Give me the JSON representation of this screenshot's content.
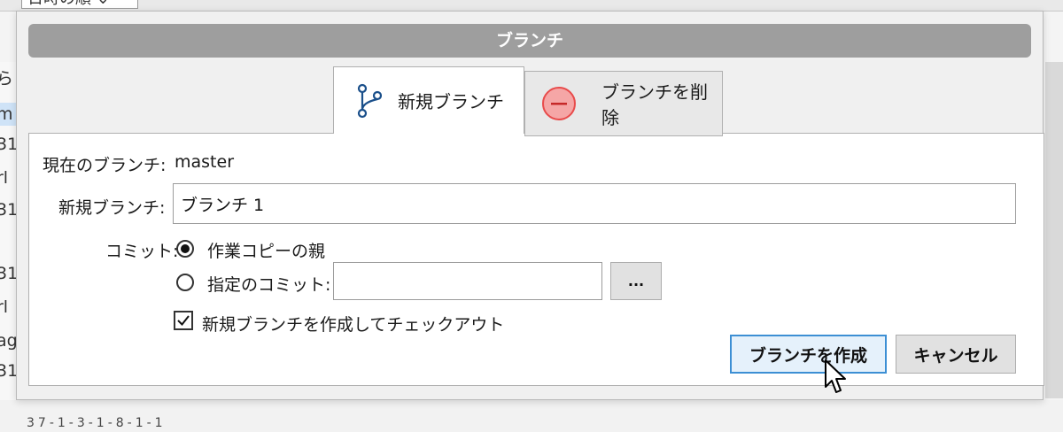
{
  "background": {
    "dropdown_text": "日時の順",
    "left_fragments": [
      "ら",
      "m",
      "31",
      "rl",
      "31",
      "31",
      "rl",
      "ag",
      "31"
    ],
    "bottom_text": "37-1-3-1-8-1-1"
  },
  "dialog": {
    "title": "ブランチ",
    "tabs": [
      {
        "label": "新規ブランチ",
        "icon": "branch-icon",
        "selected": true
      },
      {
        "label": "ブランチを削除",
        "icon": "delete-icon",
        "selected": false
      }
    ],
    "current_branch_label": "現在のブランチ:",
    "current_branch_value": "master",
    "new_branch_label": "新規ブランチ:",
    "new_branch_value": "ブランチ 1",
    "commit_label": "コミット:",
    "commit_options": [
      {
        "label": "作業コピーの親",
        "selected": true
      },
      {
        "label": "指定のコミット:",
        "selected": false
      }
    ],
    "specific_commit_value": "",
    "browse_label": "...",
    "checkout_label": "新規ブランチを作成してチェックアウト",
    "checkout_checked": true,
    "create_button": "ブランチを作成",
    "cancel_button": "キャンセル"
  },
  "colors": {
    "titlebar": "#9e9e9e",
    "primary_button_border": "#3c8fd4",
    "branch_icon": "#1a4f8a",
    "delete_icon": "#e84b4b"
  }
}
